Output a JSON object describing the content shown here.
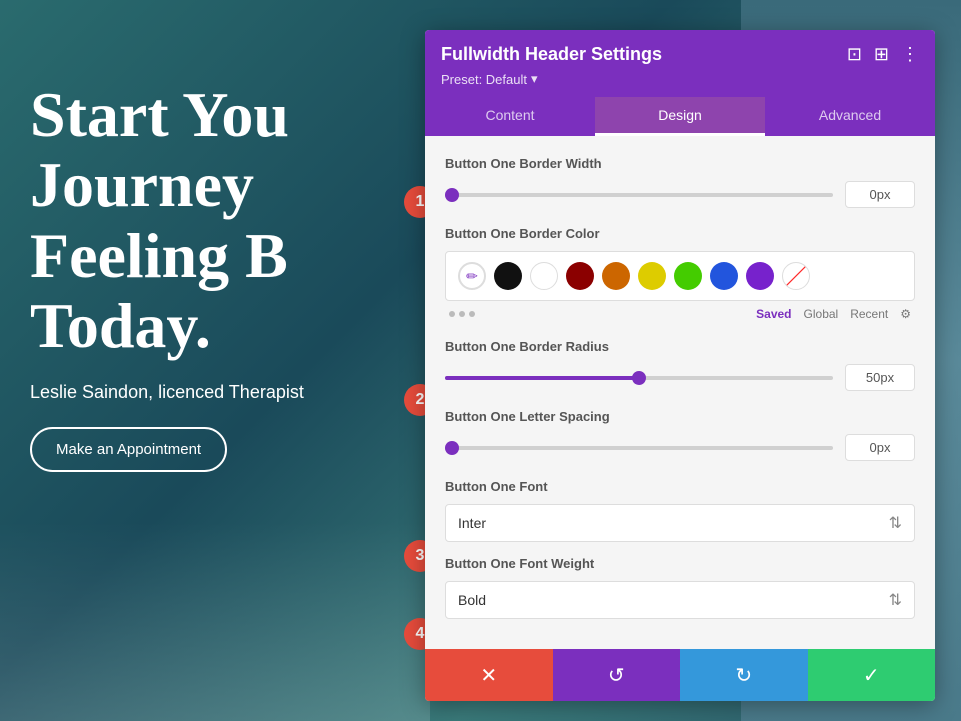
{
  "hero": {
    "title": "Start You Journey Feeling B Today.",
    "subtitle": "Leslie Saindon, licenced Therapist",
    "button_label": "Make an Appointment"
  },
  "panel": {
    "title": "Fullwidth Header Settings",
    "preset": "Preset: Default",
    "tabs": [
      "Content",
      "Design",
      "Advanced"
    ],
    "active_tab": "Design",
    "icons": [
      "⊡",
      "⊞",
      "⋮"
    ],
    "sections": {
      "border_width": {
        "label": "Button One Border Width",
        "value": "0px",
        "slider_pct": 0
      },
      "border_color": {
        "label": "Button One Border Color",
        "colors": [
          "eyedropper",
          "#111111",
          "#ffffff",
          "#8b0000",
          "#cc6600",
          "#ddcc00",
          "#44cc00",
          "#2255dd",
          "#7722cc",
          "strikethrough"
        ],
        "tabs": [
          "Saved",
          "Global",
          "Recent"
        ]
      },
      "border_radius": {
        "label": "Button One Border Radius",
        "value": "50px",
        "slider_pct": 50
      },
      "letter_spacing": {
        "label": "Button One Letter Spacing",
        "value": "0px",
        "slider_pct": 0
      },
      "font": {
        "label": "Button One Font",
        "value": "Inter"
      },
      "font_weight": {
        "label": "Button One Font Weight",
        "value": "Bold"
      }
    }
  },
  "badges": [
    "1",
    "2",
    "3",
    "4"
  ],
  "action_bar": {
    "cancel": "✕",
    "undo": "↺",
    "redo": "↻",
    "save": "✓"
  }
}
